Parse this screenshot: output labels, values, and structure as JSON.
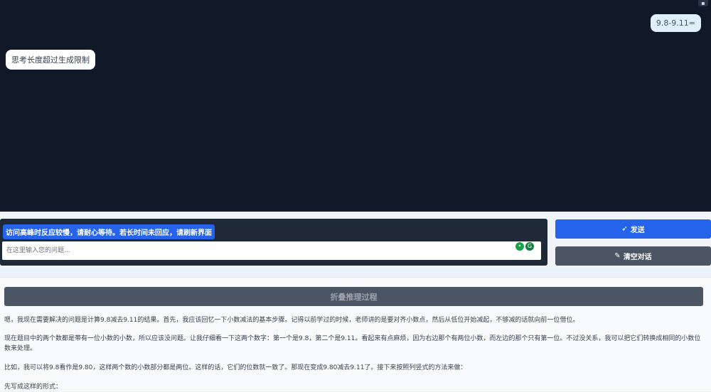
{
  "chat": {
    "user_message": "9.8-9.11=",
    "bot_message": "思考长度超过生成限制"
  },
  "input": {
    "notice": "访问高峰时反应较慢，请耐心等待。若长时间未回应，请刷新界面",
    "placeholder": "在这里输入您的问题..."
  },
  "buttons": {
    "send_label": "发送",
    "clear_label": "清空对话"
  },
  "reasoning": {
    "toggle_label": "折叠推理过程",
    "paragraphs": [
      "嗯，我现在需要解决的问题是计算9.8减去9.11的结果。首先，我应该回忆一下小数减法的基本步骤。记得以前学过的时候，老师讲的是要对齐小数点，然后从低位开始减起，不够减的话就向前一位借位。",
      "现在题目中的两个数都是带有一位小数的小数，所以应该没问题。让我仔细看一下这两个数字：第一个是9.8，第二个是9.11。看起来有点麻烦，因为右边那个有两位小数，而左边的那个只有第一位。不过没关系，我可以把它们转换成相同的小数位数来处理。",
      "比如，我可以将9.8看作是9.80，这样两个数的小数部分都是两位。这样的话，它们的位数就一致了。那现在变成9.80减去9.11了。接下来按照列竖式的方法来做：",
      "先写成这样的形式："
    ]
  }
}
